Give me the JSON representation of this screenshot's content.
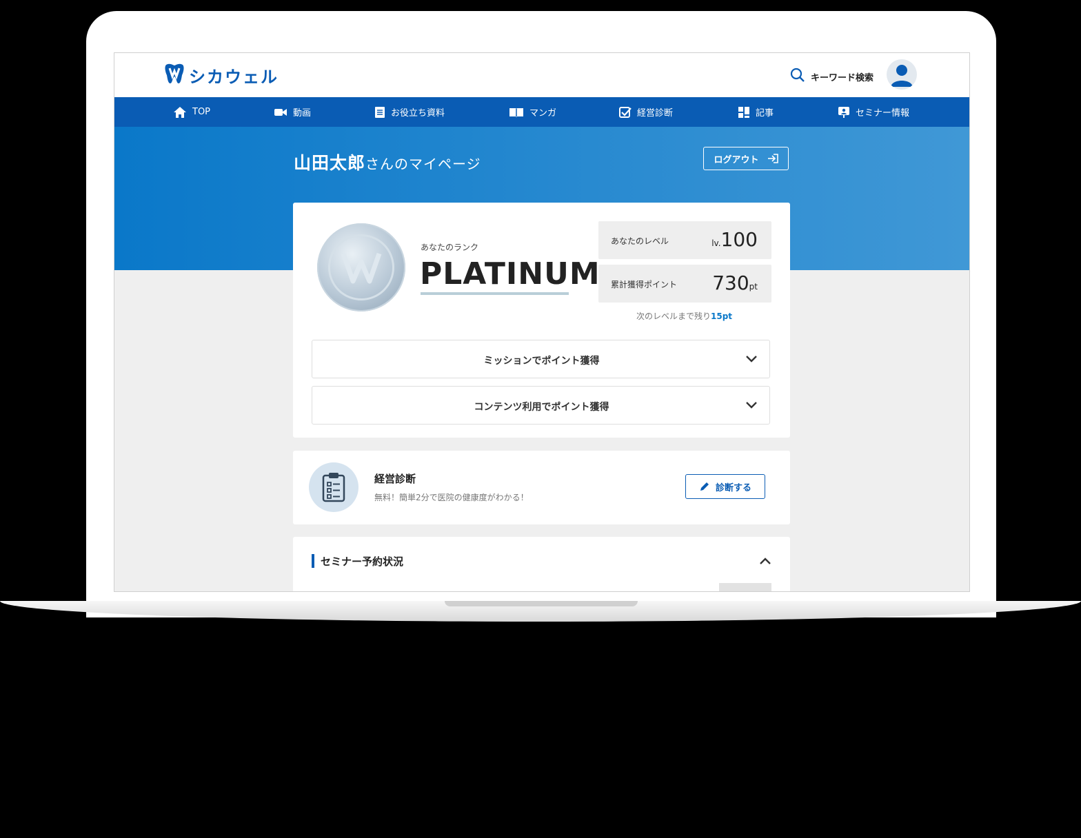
{
  "header": {
    "logo_text": "シカウェル",
    "search_label": "キーワード検索"
  },
  "nav": {
    "items": [
      {
        "label": "TOP",
        "icon": "home-icon"
      },
      {
        "label": "動画",
        "icon": "video-icon"
      },
      {
        "label": "お役立ち資料",
        "icon": "document-icon"
      },
      {
        "label": "マンガ",
        "icon": "book-icon"
      },
      {
        "label": "経営診断",
        "icon": "checkbox-icon"
      },
      {
        "label": "記事",
        "icon": "grid-icon"
      },
      {
        "label": "セミナー情報",
        "icon": "presentation-icon"
      }
    ]
  },
  "hero": {
    "name": "山田太郎",
    "suffix": "さんのマイページ",
    "logout_label": "ログアウト"
  },
  "rank": {
    "label": "あなたのランク",
    "name": "PLATINUM",
    "level_label": "あなたのレベル",
    "level_prefix": "lv.",
    "level_value": "100",
    "points_label": "累計獲得ポイント",
    "points_value": "730",
    "points_unit": "pt",
    "next_text": "次のレベルまで残り",
    "next_value": "15pt"
  },
  "accordions": [
    {
      "label": "ミッションでポイント獲得"
    },
    {
      "label": "コンテンツ利用でポイント獲得"
    }
  ],
  "diagnosis": {
    "title": "経営診断",
    "subtitle": "無料！簡単2分で医院の健康度がわかる！",
    "button_label": "診断する"
  },
  "seminar": {
    "title": "セミナー予約状況"
  },
  "colors": {
    "brand": "#0a5cb4",
    "hero_start": "#0a78c9",
    "hero_end": "#4098d6",
    "accent_text": "#0a78c9"
  }
}
